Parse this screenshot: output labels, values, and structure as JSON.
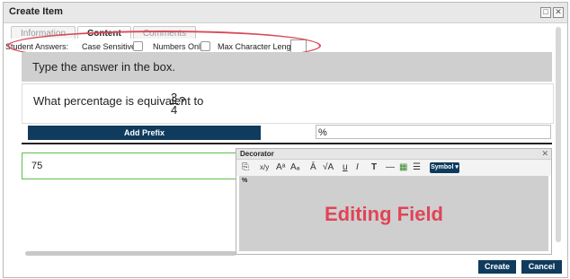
{
  "window": {
    "title": "Create Item",
    "btn_restore": "□",
    "btn_close": "✕"
  },
  "tabs": [
    {
      "label": "Information"
    },
    {
      "label": "Content"
    },
    {
      "label": "Comments"
    }
  ],
  "options": {
    "student_answers": "Student Answers:",
    "case_sensitive": "Case Sensitive:",
    "numbers_only": "Numbers Only:",
    "max_char": "Max Character Length:"
  },
  "prompt": "Type the answer in the box.",
  "question": {
    "text": "What percentage is equivalent to",
    "numerator": "3",
    "denominator": "4",
    "suffix": "?"
  },
  "prefix": {
    "button": "Add Prefix",
    "value": "%"
  },
  "answer": {
    "value": "75"
  },
  "decorator": {
    "title": "Decorator",
    "close": "✕",
    "symbol_button": "Symbol ▾",
    "content": "%",
    "annotation": "Editing Field",
    "tools": [
      "⎘",
      "x/y",
      "Aᵃ",
      "Aₐ",
      "Ā",
      "√A",
      "u",
      "I",
      "T",
      "—",
      "▦",
      "☰"
    ]
  },
  "footer": {
    "create": "Create",
    "cancel": "Cancel"
  },
  "colors": {
    "accent": "#0f3b5e",
    "highlight": "#d94a5a",
    "answer_border": "#5bbf4a"
  }
}
